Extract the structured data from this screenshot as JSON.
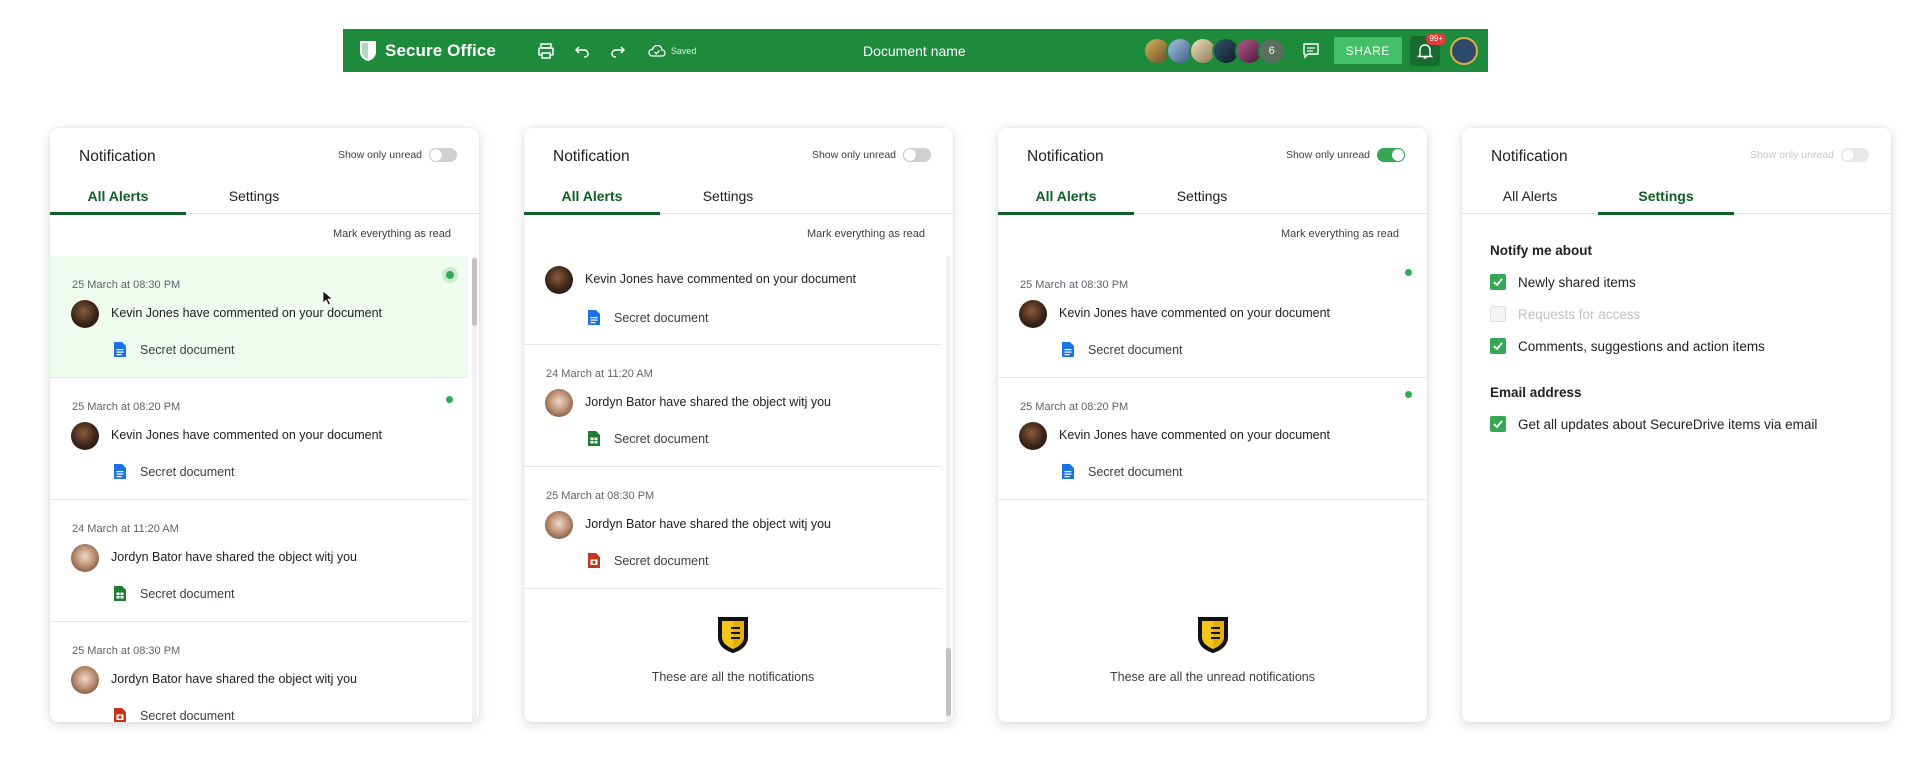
{
  "appbar": {
    "brand": "Secure Office",
    "saved_label": "Saved",
    "document_name": "Document name",
    "collaborators": [
      {
        "color": "#c9a14a"
      },
      {
        "color": "#7c9bc4"
      },
      {
        "color": "#d8c9a4"
      },
      {
        "color": "#1e3b4d"
      },
      {
        "color": "#8a3a6b"
      }
    ],
    "collaborators_more": "6",
    "share_label": "SHARE",
    "notifications_badge": "99+"
  },
  "panels": [
    {
      "title": "Notification",
      "toggle_label": "Show only unread",
      "tabs": [
        "All Alerts",
        "Settings"
      ],
      "mark_all": "Mark everything as read",
      "items": [
        {
          "time": "25 March at 08:30 PM",
          "text": "Kevin Jones have commented on your document",
          "doc": "Secret document"
        },
        {
          "time": "25 March at 08:20 PM",
          "text": "Kevin Jones have commented on your document",
          "doc": "Secret document"
        },
        {
          "time": "24 March at 11:20 AM",
          "text": "Jordyn Bator have shared the object witj you",
          "doc": "Secret document"
        },
        {
          "time": "25 March at 08:30 PM",
          "text": "Jordyn Bator have shared the object witj you",
          "doc": "Secret document"
        }
      ]
    },
    {
      "title": "Notification",
      "toggle_label": "Show only unread",
      "tabs": [
        "All Alerts",
        "Settings"
      ],
      "mark_all": "Mark everything as read",
      "items": [
        {
          "text": "Kevin Jones have commented on your document",
          "doc": "Secret document"
        },
        {
          "time": "24 March at 11:20 AM",
          "text": "Jordyn Bator have shared the object witj you",
          "doc": "Secret document"
        },
        {
          "time": "25 March at 08:30 PM",
          "text": "Jordyn Bator have shared the object witj you",
          "doc": "Secret document"
        }
      ],
      "end_text": "These are all the notifications"
    },
    {
      "title": "Notification",
      "toggle_label": "Show only unread",
      "tabs": [
        "All Alerts",
        "Settings"
      ],
      "mark_all": "Mark everything as read",
      "items": [
        {
          "time": "25 March at 08:30 PM",
          "text": "Kevin Jones have commented on your document",
          "doc": "Secret document"
        },
        {
          "time": "25 March at 08:20 PM",
          "text": "Kevin Jones have commented on your document",
          "doc": "Secret document"
        }
      ],
      "end_text": "These are all the unread notifications"
    },
    {
      "title": "Notification",
      "toggle_label": "Show only unread",
      "tabs": [
        "All Alerts",
        "Settings"
      ],
      "settings": {
        "notify_heading": "Notify me about",
        "notify_options": [
          {
            "label": "Newly shared items",
            "checked": true
          },
          {
            "label": "Requests for access",
            "checked": false
          },
          {
            "label": "Comments, suggestions and action items",
            "checked": true
          }
        ],
        "email_heading": "Email address",
        "email_options": [
          {
            "label": "Get all updates about SecureDrive items via email",
            "checked": true
          }
        ]
      }
    }
  ],
  "colors": {
    "brand_green": "#1e8a3c",
    "accent_green": "#34a853",
    "tab_active": "#0d5f25",
    "doc_blue": "#1a73e8",
    "sheet_green": "#1e7e34",
    "slides_red": "#c5341c",
    "shield_yellow": "#f5c518"
  }
}
